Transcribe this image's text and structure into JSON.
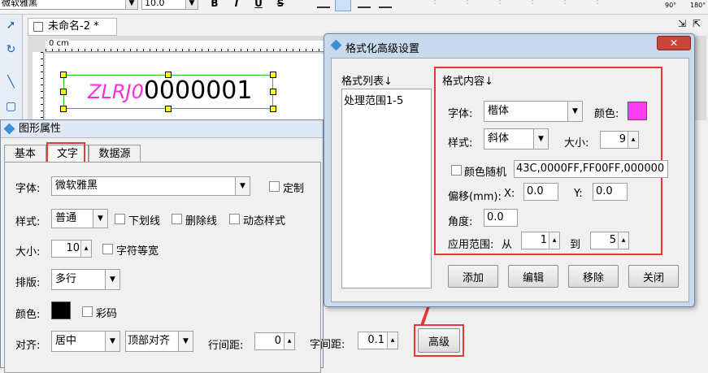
{
  "toolbar": {
    "font_name": "微软雅黑",
    "font_size": "10.0",
    "bold": "B",
    "italic": "I",
    "underline": "U",
    "strikethrough": "S",
    "rotate_90": "90°",
    "rotate_180": "180°"
  },
  "document": {
    "tab_title": "未命名-2 *",
    "ruler_label": "0 cm",
    "barcode_prefix": "ZLRJ0",
    "barcode_number": "0000001",
    "prefix_color": "#ff2fd8"
  },
  "props": {
    "title": "图形属性",
    "tabs": [
      "基本",
      "文字",
      "数据源"
    ],
    "active_tab": "文字",
    "font_label": "字体:",
    "font_value": "微软雅黑",
    "custom_label": "定制",
    "style_label": "样式:",
    "style_value": "普通",
    "underline_label": "下划线",
    "strike_label": "删除线",
    "dynamic_label": "动态样式",
    "size_label": "大小:",
    "size_value": "10",
    "monospace_label": "字符等宽",
    "layout_label": "排版:",
    "layout_value": "多行",
    "color_label": "颜色:",
    "color_value": "#000000",
    "colorful_label": "彩码",
    "align_label": "对齐:",
    "align_h": "居中",
    "align_v": "顶部对齐",
    "line_spacing_label": "行间距:",
    "line_spacing_value": "0",
    "char_spacing_label": "字间距:",
    "char_spacing_value": "0.1",
    "advanced_button": "高级"
  },
  "dialog": {
    "title": "格式化高级设置",
    "close": "✕",
    "list_header": "格式列表↓",
    "list_items": [
      "处理范围1-5"
    ],
    "content_header": "格式内容↓",
    "font_label": "字体:",
    "font_value": "楷体",
    "color_label": "颜色:",
    "color_value": "#ff3cf5",
    "style_label": "样式:",
    "style_value": "斜体",
    "size_label": "大小:",
    "size_value": "9",
    "random_color_label": "颜色随机",
    "random_color_value": "43C,0000FF,FF00FF,000000",
    "offset_label": "偏移(mm):",
    "x_label": "X:",
    "x_value": "0.0",
    "y_label": "Y:",
    "y_value": "0.0",
    "angle_label": "角度:",
    "angle_value": "0.0",
    "range_label": "应用范围:",
    "from_label": "从",
    "from_value": "1",
    "to_label": "到",
    "to_value": "5",
    "buttons": [
      "添加",
      "编辑",
      "移除",
      "关闭"
    ]
  },
  "colors": {
    "highlight": "#e23a3a",
    "selection": "#2fbf2f"
  }
}
